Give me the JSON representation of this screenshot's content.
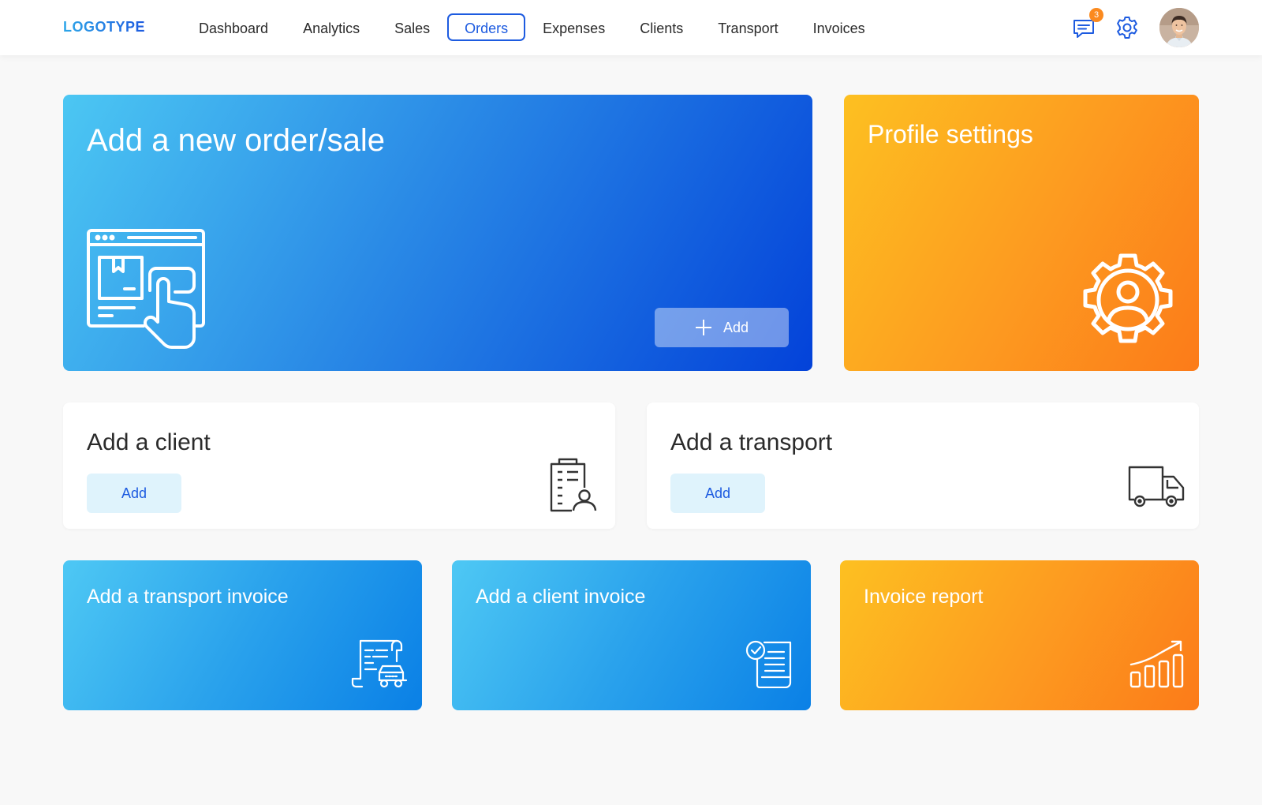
{
  "header": {
    "logo": "LOGOTYPE",
    "nav": [
      {
        "label": "Dashboard",
        "active": false
      },
      {
        "label": "Analytics",
        "active": false
      },
      {
        "label": "Sales",
        "active": false
      },
      {
        "label": "Orders",
        "active": true
      },
      {
        "label": "Expenses",
        "active": false
      },
      {
        "label": "Clients",
        "active": false
      },
      {
        "label": "Transport",
        "active": false
      },
      {
        "label": "Invoices",
        "active": false
      }
    ],
    "messages_badge": "3",
    "icons": [
      "message-icon",
      "gear-icon",
      "avatar"
    ]
  },
  "hero": {
    "title": "Add a new order/sale",
    "add_label": "Add",
    "icon": "order-browser-icon"
  },
  "profile": {
    "title": "Profile settings",
    "icon": "user-gear-icon"
  },
  "client": {
    "title": "Add a client",
    "add_label": "Add",
    "icon": "client-building-icon"
  },
  "transport": {
    "title": "Add a transport",
    "add_label": "Add",
    "icon": "truck-icon"
  },
  "transport_invoice": {
    "title": "Add a transport invoice",
    "icon": "transport-invoice-icon"
  },
  "client_invoice": {
    "title": "Add a client invoice",
    "icon": "client-invoice-icon"
  },
  "invoice_report": {
    "title": "Invoice report",
    "icon": "bar-chart-growth-icon"
  },
  "colors": {
    "accent_blue": "#1d5be0",
    "accent_orange": "#fc7b19",
    "light_button": "#dff3fc"
  }
}
